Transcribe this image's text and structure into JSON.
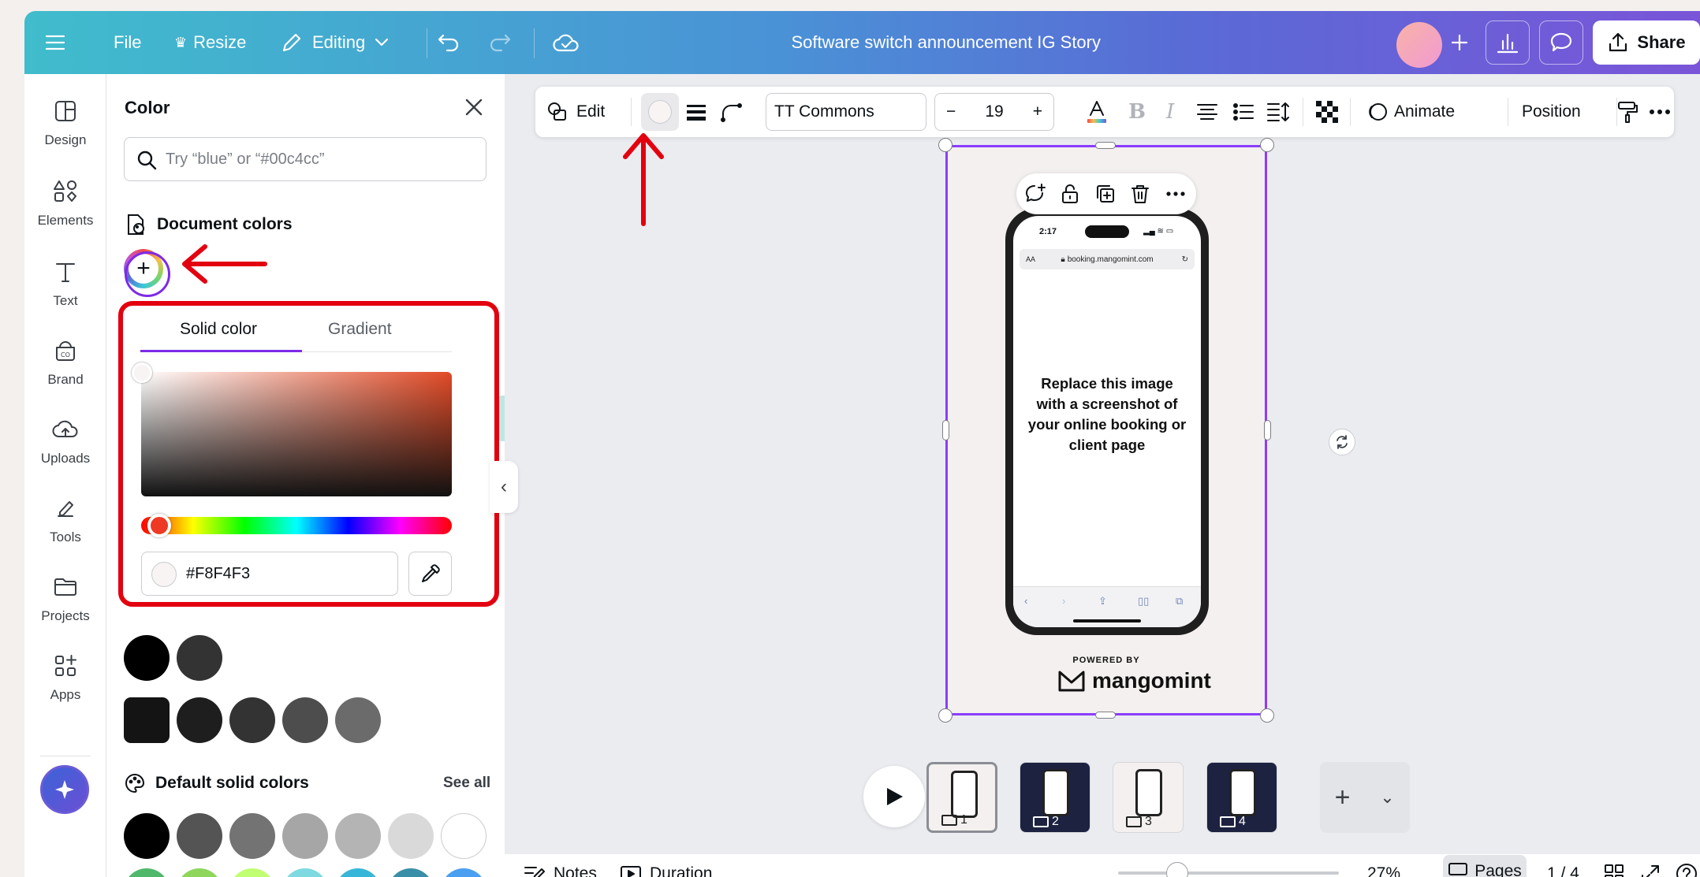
{
  "topbar": {
    "file": "File",
    "resize": "Resize",
    "editing": "Editing",
    "title": "Software switch announcement IG Story",
    "share": "Share"
  },
  "rail": {
    "items": [
      {
        "label": "Design",
        "icon": "design-icon"
      },
      {
        "label": "Elements",
        "icon": "elements-icon"
      },
      {
        "label": "Text",
        "icon": "text-icon"
      },
      {
        "label": "Brand",
        "icon": "brand-icon"
      },
      {
        "label": "Uploads",
        "icon": "uploads-icon"
      },
      {
        "label": "Tools",
        "icon": "tools-icon"
      },
      {
        "label": "Projects",
        "icon": "projects-icon"
      },
      {
        "label": "Apps",
        "icon": "apps-icon"
      }
    ]
  },
  "panel": {
    "title": "Color",
    "search_placeholder": "Try “blue” or “#00c4cc”",
    "document_colors": "Document colors",
    "default_solid": "Default solid colors",
    "see_all": "See all",
    "peek_edit": "it",
    "peek_all": "all",
    "brand_swatches": [
      "#000000",
      "#333333"
    ],
    "palette_swatches": [
      "#141414",
      "#1e1e1e",
      "#333333",
      "#4d4d4d",
      "#6b6b6b"
    ],
    "default_swatches": [
      "#000000",
      "#545454",
      "#737373",
      "#a6a6a6",
      "#b4b4b4",
      "#d9d9d9",
      "#ffffff"
    ],
    "next_row": [
      "#50b86a",
      "#8fd65c",
      "#c1ff72",
      "#7ed9e0",
      "#38b6d9",
      "#3a8fa8",
      "#4a9ff0"
    ]
  },
  "picker": {
    "tab_solid": "Solid color",
    "tab_gradient": "Gradient",
    "hex": "#F8F4F3",
    "accent": "#e24a26"
  },
  "ctx": {
    "edit": "Edit",
    "font": "TT Commons",
    "size": "19",
    "animate": "Animate",
    "position": "Position"
  },
  "canvas": {
    "phone_time": "2:17",
    "phone_aa": "AA",
    "phone_url": "booking.mangomint.com",
    "phone_text": "Replace this image with a screenshot of your online booking or client page",
    "powered_by": "POWERED BY",
    "brand": "mangomint"
  },
  "pages": [
    {
      "num": "1",
      "dark": false
    },
    {
      "num": "2",
      "dark": true
    },
    {
      "num": "3",
      "dark": false
    },
    {
      "num": "4",
      "dark": true
    }
  ],
  "bottom": {
    "notes": "Notes",
    "duration": "Duration",
    "zoom": "27%",
    "pages": "Pages",
    "page_count": "1 / 4"
  },
  "colors": {
    "selection": "#8b3dff",
    "annotation": "#e3000f"
  }
}
